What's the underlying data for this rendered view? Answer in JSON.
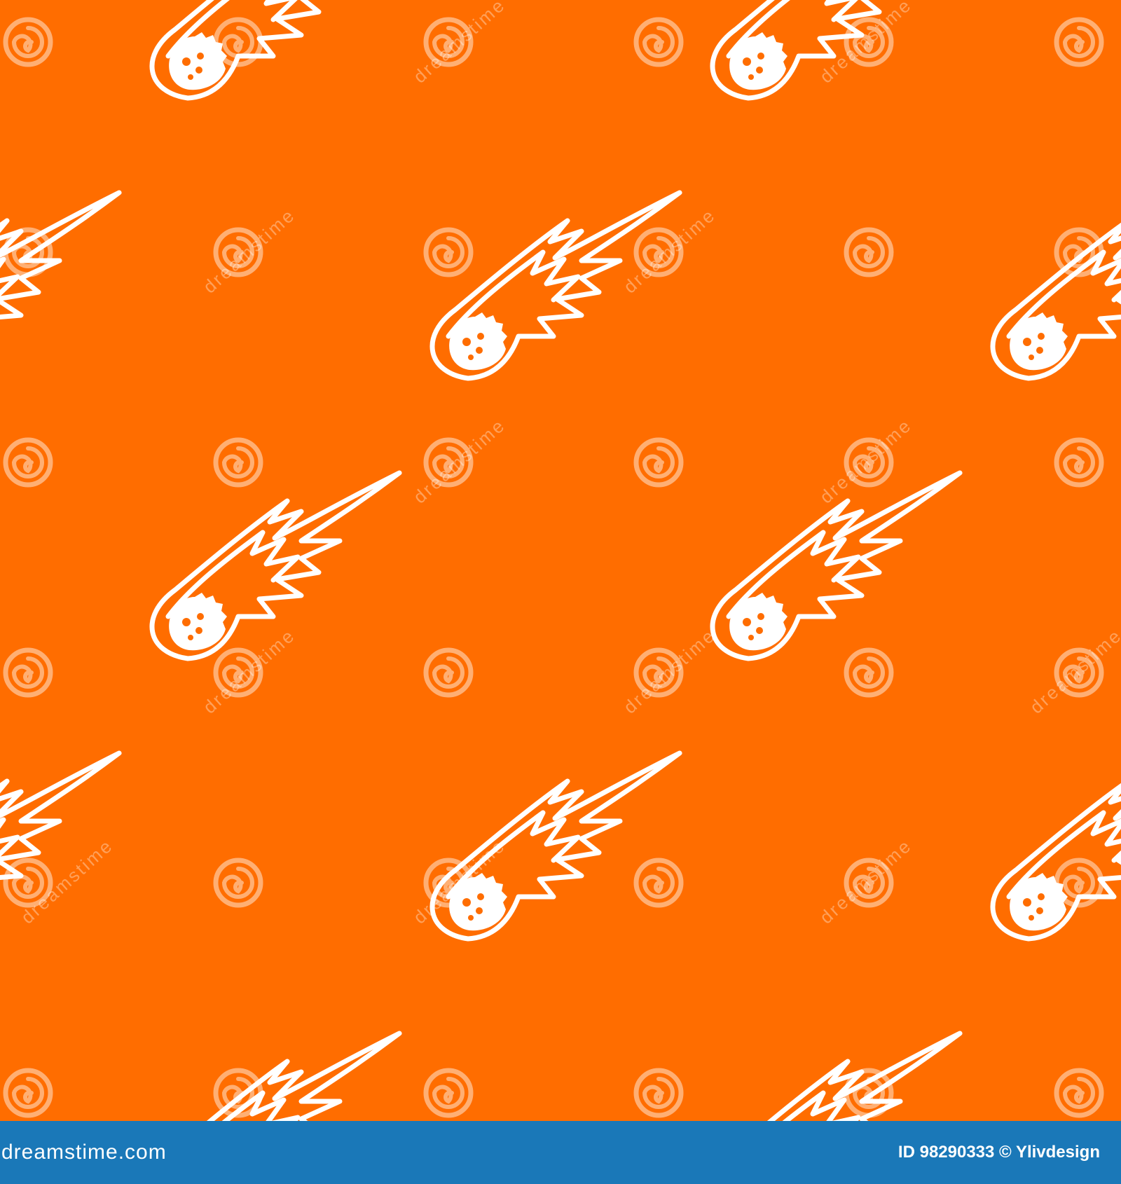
{
  "pattern": {
    "background_color": "#ff6d00",
    "motif_icon": "comet-icon",
    "motif_color": "#ffffff",
    "watermark_icon": "spiral-logo-icon",
    "watermark_text": "dreamstime"
  },
  "footer": {
    "background_color": "#1a78b8",
    "logo_text": "dreamstime.com",
    "credit_text": "ID 98290333 © Ylivdesign"
  }
}
